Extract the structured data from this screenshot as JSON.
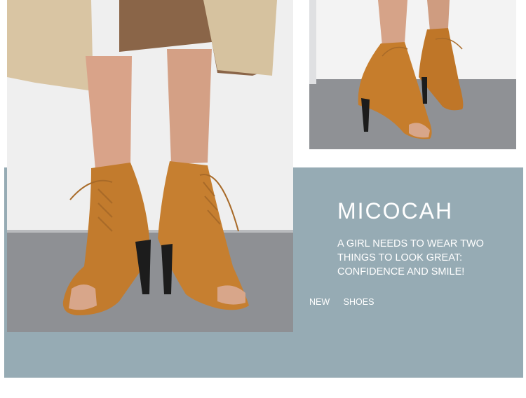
{
  "brand": {
    "name": "MICOCAH"
  },
  "tagline": "A GIRL NEEDS TO WEAR TWO THINGS TO LOOK GREAT: CONFIDENCE AND SMILE!",
  "tags": [
    "NEW",
    "SHOES"
  ],
  "colors": {
    "panel": "#96abb4",
    "boot": "#c07a2c",
    "boot_dark": "#8f5618",
    "coat": "#dcc8a6",
    "floor": "#8e9094",
    "wall": "#eeeeee"
  }
}
